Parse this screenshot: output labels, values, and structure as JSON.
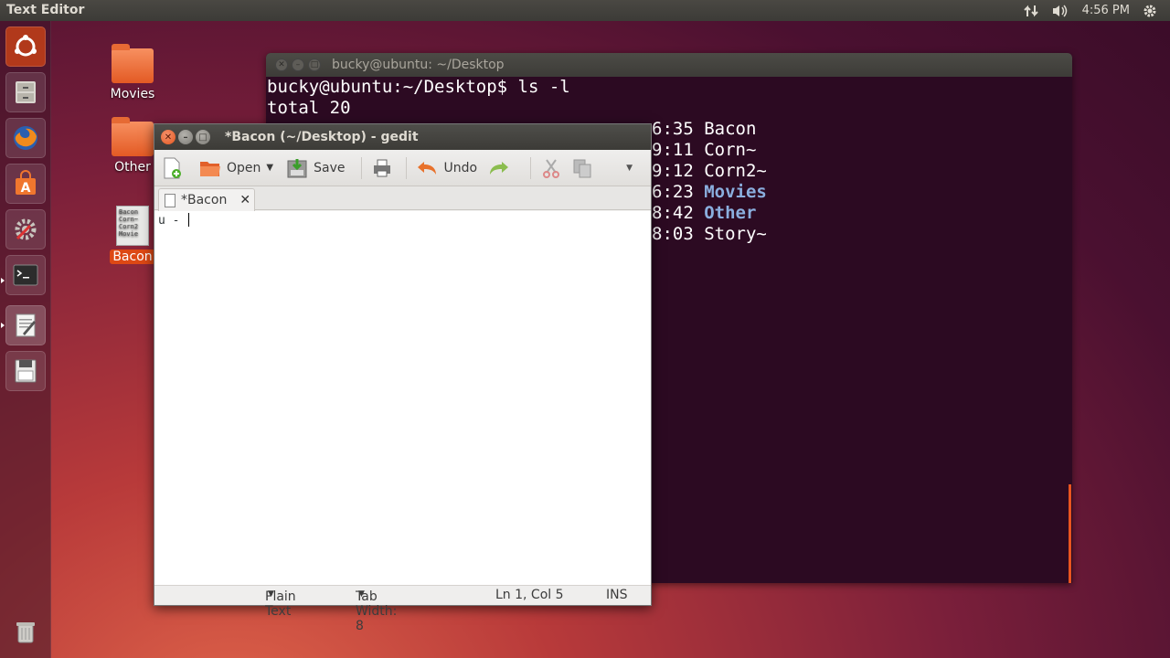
{
  "top_panel": {
    "app_title": "Text Editor",
    "clock": "4:56 PM"
  },
  "desktop": {
    "icons": [
      {
        "label": "Movies"
      },
      {
        "label": "Other"
      },
      {
        "label": "Bacon",
        "thumb": "Bacon\nCorn~\nCorn2\nMovie"
      }
    ]
  },
  "terminal": {
    "title": "bucky@ubuntu: ~/Desktop",
    "prompt": "bucky@ubuntu:~/Desktop$ ls -l",
    "total": "total 20",
    "rows": [
      {
        "time": "6:35",
        "name": "Bacon",
        "is_dir": false
      },
      {
        "time": "9:11",
        "name": "Corn~",
        "is_dir": false
      },
      {
        "time": "9:12",
        "name": "Corn2~",
        "is_dir": false
      },
      {
        "time": "6:23",
        "name": "Movies",
        "is_dir": true
      },
      {
        "time": "8:42",
        "name": "Other",
        "is_dir": true
      },
      {
        "time": "8:03",
        "name": "Story~",
        "is_dir": false
      }
    ]
  },
  "gedit": {
    "title": "*Bacon (~/Desktop) - gedit",
    "toolbar": {
      "open_label": "Open",
      "save_label": "Save",
      "undo_label": "Undo"
    },
    "tab_label": "*Bacon",
    "content": "u - ",
    "status": {
      "language": "Plain Text",
      "tab_width": "Tab Width: 8",
      "position": "Ln 1, Col 5",
      "mode": "INS"
    }
  },
  "colors": {
    "accent": "#dd4814",
    "terminal_bg": "#2c0a22",
    "dir_color": "#8aaede"
  }
}
